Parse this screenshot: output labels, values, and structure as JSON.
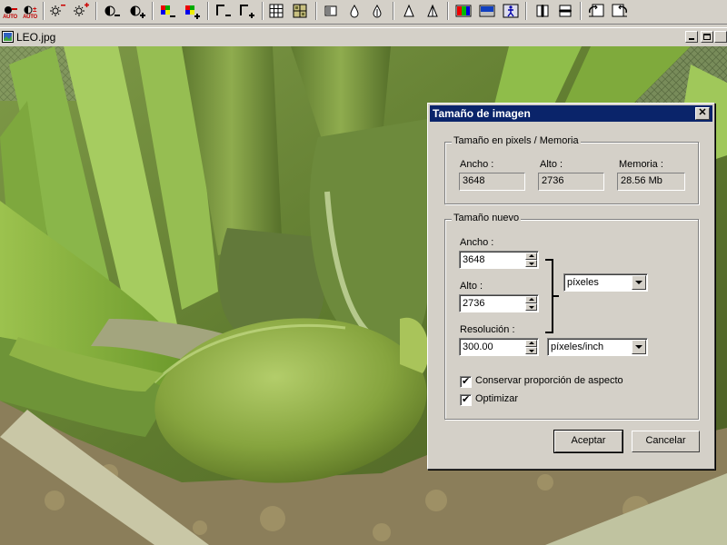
{
  "toolbar": {
    "auto_label": "AUTO",
    "icons": [
      "brightness-auto-icon",
      "contrast-auto-icon",
      "brightness-down-icon",
      "brightness-up-icon",
      "contrast-down-icon",
      "contrast-up-icon",
      "saturation-down-icon",
      "saturation-up-icon",
      "gamma-down-icon",
      "gamma-up-icon",
      "grid-icon",
      "grid-alt-icon",
      "sharpen-icon",
      "blur-icon",
      "drop-icon",
      "triangle-icon",
      "triangle-alt-icon",
      "color-balance-icon",
      "screen-icon",
      "effect-icon",
      "flip-icon",
      "mirror-icon",
      "rotate-left-icon",
      "rotate-right-icon"
    ]
  },
  "document": {
    "title": "LEO.jpg"
  },
  "dialog": {
    "title": "Tamaño de imagen",
    "close_label": "✕",
    "current_group": {
      "title": "Tamaño en pixels / Memoria",
      "width_label": "Ancho :",
      "width_value": "3648",
      "height_label": "Alto :",
      "height_value": "2736",
      "memory_label": "Memoria :",
      "memory_value": "28.56 Mb"
    },
    "new_group": {
      "title": "Tamaño nuevo",
      "width_label": "Ancho :",
      "width_value": "3648",
      "height_label": "Alto :",
      "height_value": "2736",
      "unit_value": "píxeles",
      "resolution_label": "Resolución :",
      "resolution_value": "300.00",
      "resolution_unit": "píxeles/inch",
      "keep_aspect_label": "Conservar proporción de aspecto",
      "keep_aspect_checked": true,
      "optimize_label": "Optimizar",
      "optimize_checked": true
    },
    "ok_label": "Aceptar",
    "cancel_label": "Cancelar"
  }
}
